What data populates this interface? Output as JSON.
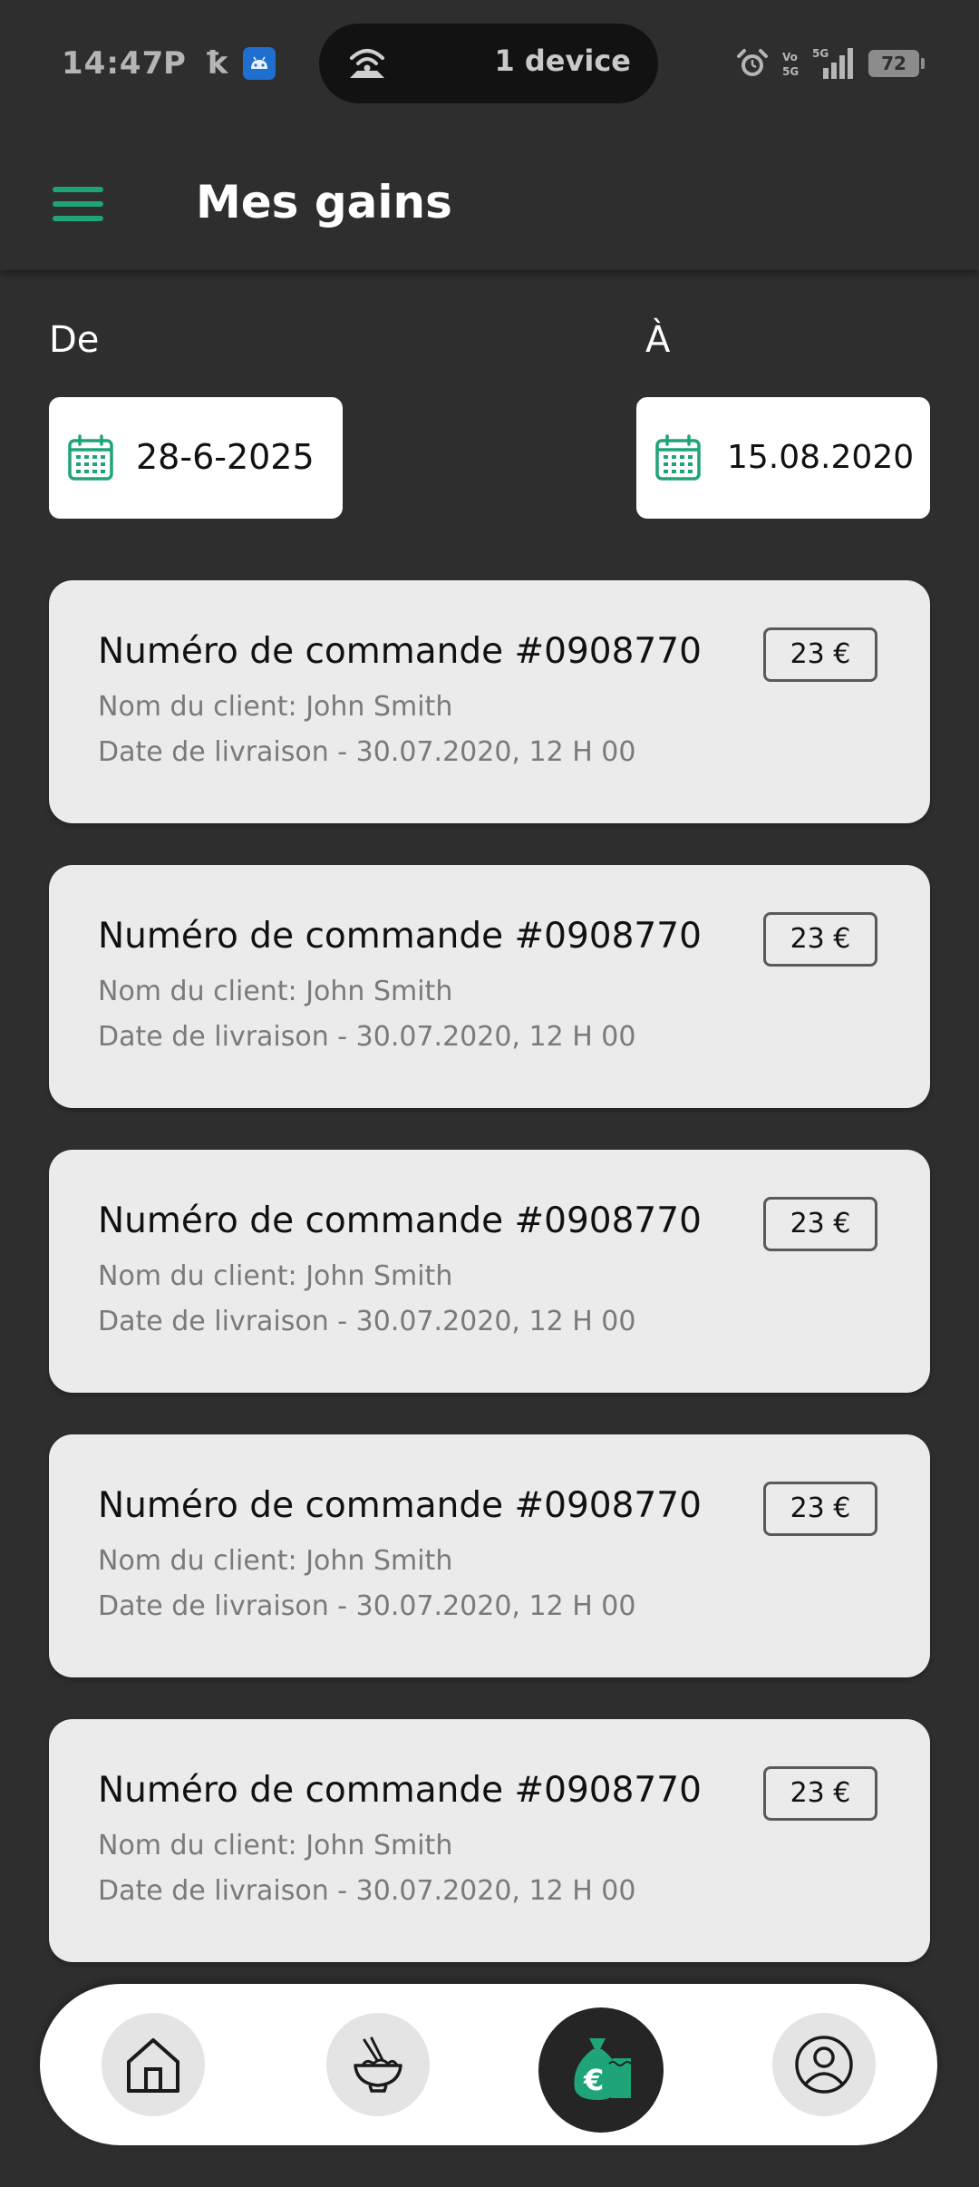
{
  "status_bar": {
    "time": "14:47",
    "notif_p": "P",
    "notif_k": "ꝁ",
    "hotspot_text": "1 device",
    "battery": "72",
    "network": "5G"
  },
  "app_bar": {
    "title": "Mes gains"
  },
  "date_filter": {
    "from_label": "De",
    "from_value": "28-6-2025",
    "to_label": "À",
    "to_value": "15.08.2020"
  },
  "orders": [
    {
      "title": "Numéro de commande #0908770",
      "client": "Nom du client: John Smith",
      "delivery": "Date de livraison - 30.07.2020, 12 H 00",
      "amount": "23 €"
    },
    {
      "title": "Numéro de commande #0908770",
      "client": "Nom du client: John Smith",
      "delivery": "Date de livraison - 30.07.2020, 12 H 00",
      "amount": "23 €"
    },
    {
      "title": "Numéro de commande #0908770",
      "client": "Nom du client: John Smith",
      "delivery": "Date de livraison - 30.07.2020, 12 H 00",
      "amount": "23 €"
    },
    {
      "title": "Numéro de commande #0908770",
      "client": "Nom du client: John Smith",
      "delivery": "Date de livraison - 30.07.2020, 12 H 00",
      "amount": "23 €"
    },
    {
      "title": "Numéro de commande #0908770",
      "client": "Nom du client: John Smith",
      "delivery": "Date de livraison - 30.07.2020, 12 H 00",
      "amount": "23 €"
    }
  ],
  "bottom_nav": {
    "items": [
      {
        "icon": "home-icon",
        "active": false
      },
      {
        "icon": "food-bowl-icon",
        "active": false
      },
      {
        "icon": "money-bag-icon",
        "active": true
      },
      {
        "icon": "profile-icon",
        "active": false
      }
    ]
  },
  "colors": {
    "accent": "#1fa47a",
    "background": "#2e2e2e",
    "card": "#ebebeb",
    "nav_active": "#252525"
  }
}
